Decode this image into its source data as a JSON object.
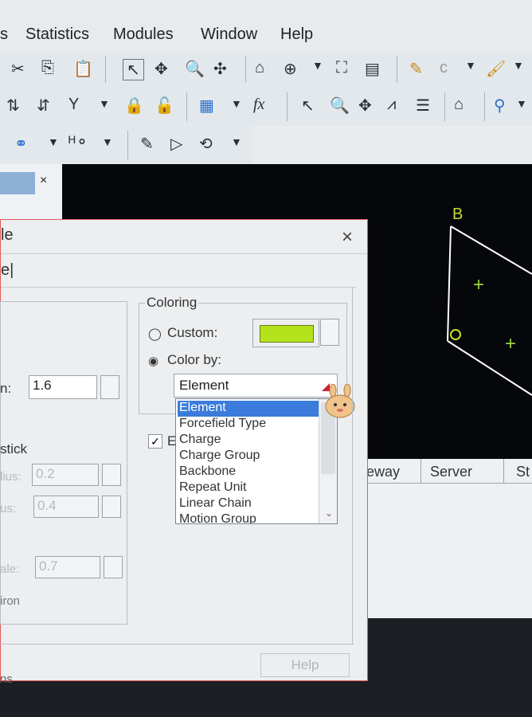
{
  "menubar": {
    "items": [
      "s",
      "Statistics",
      "Modules",
      "Window",
      "Help"
    ]
  },
  "toolbar1": {
    "icons": [
      "cut-icon",
      "copy-icon",
      "paste-icon",
      "select-arrow-icon",
      "move-icon",
      "zoom-icon",
      "pan-icon",
      "home-icon",
      "crosshair-icon",
      "fit-icon",
      "wizard-icon",
      "pencil-icon",
      "brush-icon"
    ]
  },
  "toolbar2": {
    "icons": [
      "sort-asc-icon",
      "sort-desc-icon",
      "filter-icon",
      "lock-icon",
      "unlock-icon",
      "grid-icon",
      "fx-icon",
      "arrow-icon",
      "magnify-icon",
      "move-icon",
      "peak-icon",
      "bars-icon",
      "home-icon",
      "tree-icon"
    ]
  },
  "toolbar3": {
    "icons": [
      "atom-icon",
      "hydrogen-icon",
      "edit-icon",
      "play-icon",
      "rotate-icon"
    ]
  },
  "lefttab": {
    "close": "×"
  },
  "viewer": {
    "label_b": "B",
    "label_o": "O",
    "plus1": "+",
    "plus2": "+"
  },
  "lowerpanel": {
    "tabs": [
      "eway",
      "Server",
      "St"
    ]
  },
  "dialog": {
    "title": "le",
    "close": "×",
    "tab_marker": "e|",
    "left": {
      "radius_label": "n:",
      "radius_value": "1.6",
      "stick_label": "stick",
      "field1_value": "0.2",
      "field2_value": "0.4",
      "field3_value": "0.7",
      "dim_label1": "lius:",
      "dim_label2": "us:",
      "dim_label3": "ale:",
      "extra_label": "iron"
    },
    "coloring": {
      "legend": "Coloring",
      "custom_label": "Custom:",
      "colorby_label": "Color by:",
      "selected": "Element",
      "options": [
        "Element",
        "Forcefield Type",
        "Charge",
        "Charge Group",
        "Backbone",
        "Repeat Unit",
        "Linear Chain",
        "Motion Group"
      ],
      "swatch_color": "#b4e31c"
    },
    "checkbox_label": "E",
    "help_label": "Help",
    "bottom_label": "ns"
  }
}
